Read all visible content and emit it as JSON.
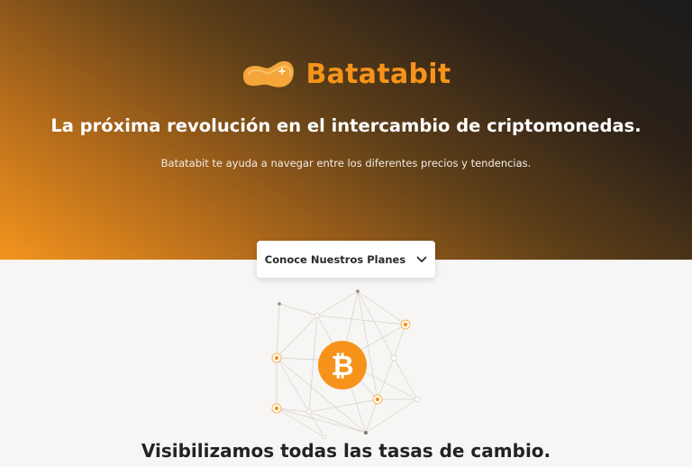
{
  "brand": {
    "name": "Batatabit",
    "logo_icon": "sweet-potato-icon",
    "accent_color": "#f7931a"
  },
  "hero": {
    "headline": "La próxima revolución en el intercambio de criptomonedas.",
    "subheadline": "Batatabit te ayuda a navegar entre los diferentes precios y tendencias."
  },
  "cta": {
    "label": "Conoce Nuestros Planes",
    "icon": "chevron-down-icon"
  },
  "illustration": {
    "center_icon": "bitcoin-icon",
    "symbol": "₿",
    "node_icon": "network-node-icon"
  },
  "rates_section": {
    "title": "Visibilizamos todas las tasas de cambio."
  }
}
